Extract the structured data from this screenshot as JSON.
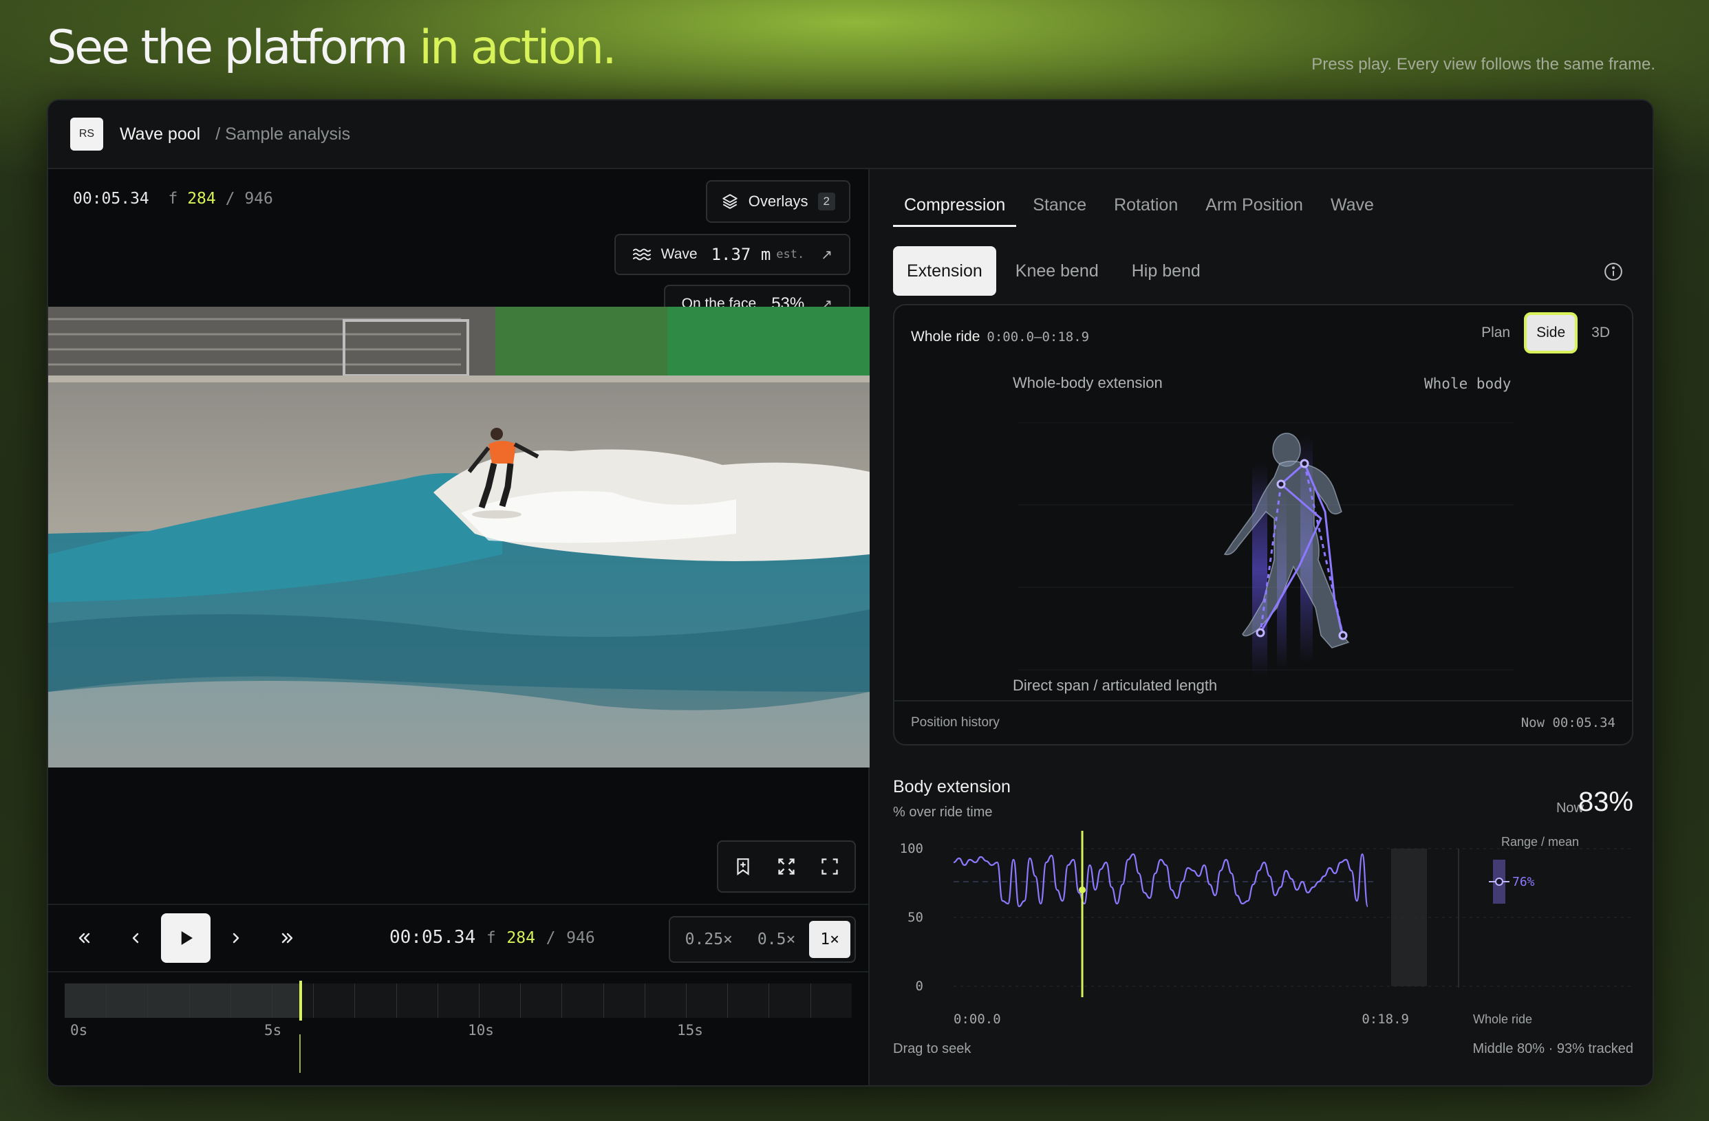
{
  "headline": {
    "main": "See the platform ",
    "accent": "in action."
  },
  "tagline": "Press play. Every view follows the same frame.",
  "header": {
    "logo": "RS",
    "project": "Wave pool",
    "breadcrumb": "/ Sample analysis"
  },
  "video": {
    "time": "00:05.34",
    "frame_prefix": "f",
    "frame": "284",
    "frame_sep": "/",
    "frame_total": "946",
    "overlays": {
      "label": "Overlays",
      "count": "2"
    },
    "wave": {
      "label": "Wave",
      "value": "1.37 m",
      "qualifier": "est."
    },
    "face": {
      "label": "On the face",
      "value": "53%"
    },
    "tools": [
      "bookmark-add-icon",
      "fit-screen-icon",
      "fullscreen-icon"
    ],
    "speeds": [
      "0.25×",
      "0.5×",
      "1×"
    ],
    "active_speed": "1×",
    "timeline_labels": [
      "0s",
      "5s",
      "10s",
      "15s"
    ],
    "playhead_seconds": 5.34,
    "duration_seconds": 18.9
  },
  "analysis": {
    "tabs": [
      "Compression",
      "Stance",
      "Rotation",
      "Arm Position",
      "Wave"
    ],
    "active_tab": "Compression",
    "subtabs": [
      "Extension",
      "Knee bend",
      "Hip bend"
    ],
    "active_subtab": "Extension",
    "viz": {
      "range_label": "Whole ride",
      "range": "0:00.0–0:18.9",
      "views": [
        "Plan",
        "Side",
        "3D"
      ],
      "active_view": "Side",
      "label_left": "Whole-body extension",
      "label_right": "Whole body",
      "label_bottom": "Direct span / articulated length",
      "footer_left": "Position history",
      "footer_right": "Now 00:05.34"
    },
    "chart": {
      "title": "Body extension",
      "subtitle": "% over ride time",
      "now_label": "Now",
      "now_value": "83%",
      "range_header": "Range / mean",
      "mean_label": "76%",
      "whole_ride_label": "Whole ride",
      "footer_left": "Drag to seek",
      "footer_right": "Middle 80% · 93% tracked"
    }
  },
  "chart_data": {
    "type": "line",
    "title": "Body extension",
    "ylabel": "% over ride time",
    "ylim": [
      0,
      100
    ],
    "yticks": [
      "100",
      "50",
      "0"
    ],
    "xticks": [
      "0:00.0",
      "0:18.9"
    ],
    "x_range_seconds": [
      0,
      18.9
    ],
    "cursor_seconds": 5.34,
    "mean": 76,
    "range_p10_p90": [
      60,
      92
    ],
    "series": [
      {
        "values": [
          90,
          93,
          88,
          92,
          90,
          94,
          91,
          88,
          90,
          62,
          60,
          92,
          58,
          62,
          93,
          80,
          60,
          90,
          95,
          70,
          62,
          88,
          92,
          68,
          60,
          88,
          70,
          85,
          90,
          72,
          60,
          74,
          92,
          96,
          82,
          68,
          64,
          82,
          92,
          88,
          70,
          64,
          76,
          86,
          84,
          80,
          88,
          74,
          66,
          84,
          92,
          82,
          66,
          60,
          62,
          74,
          84,
          90,
          80,
          66,
          72,
          84,
          78,
          70,
          76,
          68,
          72,
          76,
          80,
          86,
          82,
          90,
          92,
          84,
          62,
          96,
          58
        ]
      }
    ],
    "color": "#8d79ff"
  }
}
